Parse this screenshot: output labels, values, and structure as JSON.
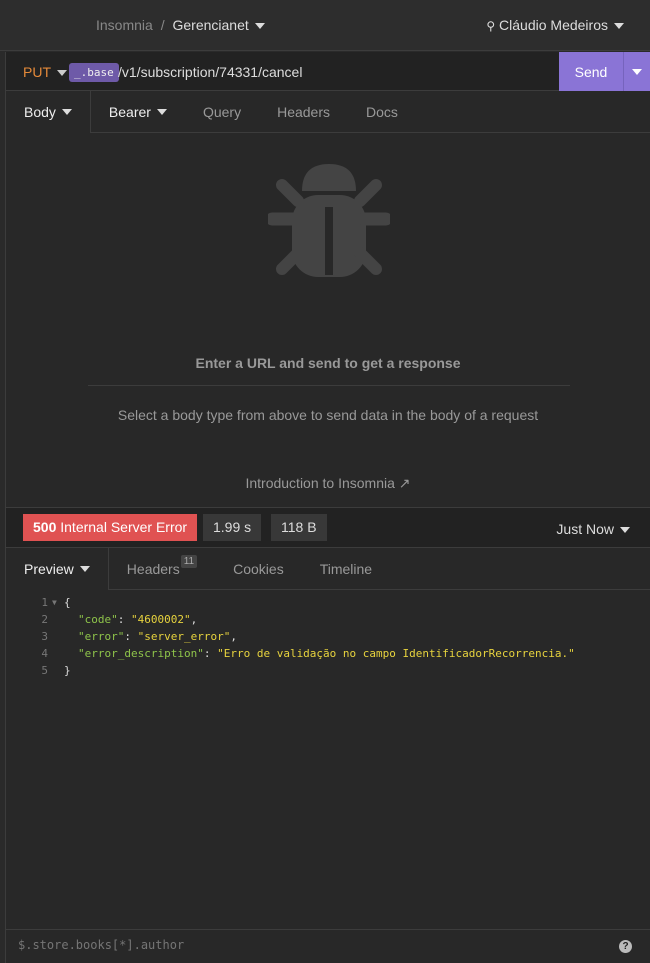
{
  "header": {
    "app": "Insomnia",
    "separator": "/",
    "workspace": "Gerencianet",
    "user": "Cláudio Medeiros"
  },
  "request": {
    "method": "PUT",
    "base_tag": "_.base",
    "path": "/v1/subscription/74331/cancel",
    "send_label": "Send",
    "tabs": [
      {
        "label": "Body"
      },
      {
        "label": "Bearer"
      },
      {
        "label": "Query"
      },
      {
        "label": "Headers"
      },
      {
        "label": "Docs"
      }
    ]
  },
  "empty_state": {
    "title": "Enter a URL and send to get a response",
    "subtitle": "Select a body type from above to send data in the body of a request",
    "link": "Introduction to Insomnia"
  },
  "response": {
    "status_code": "500",
    "status_text": "Internal Server Error",
    "time": "1.99 s",
    "size": "118 B",
    "history": "Just Now",
    "status_color": "#e05252",
    "tabs": [
      {
        "label": "Preview"
      },
      {
        "label": "Headers",
        "badge": "11"
      },
      {
        "label": "Cookies"
      },
      {
        "label": "Timeline"
      }
    ],
    "lines": [
      {
        "n": "1",
        "key": "",
        "val": "",
        "text": "{"
      },
      {
        "n": "2",
        "key": "\"code\"",
        "val": "\"4600002\"",
        "text": ","
      },
      {
        "n": "3",
        "key": "\"error\"",
        "val": "\"server_error\"",
        "text": ","
      },
      {
        "n": "4",
        "key": "\"error_description\"",
        "val": "\"Erro de validação no campo IdentificadorRecorrencia.\"",
        "text": ""
      },
      {
        "n": "5",
        "key": "",
        "val": "",
        "text": "}"
      }
    ]
  },
  "filter": {
    "placeholder": "$.store.books[*].author",
    "help": "?"
  }
}
